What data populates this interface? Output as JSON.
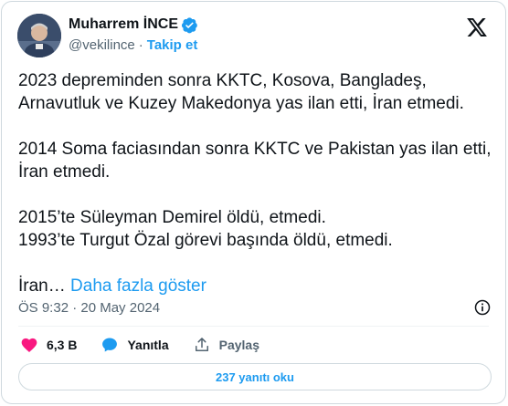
{
  "author": {
    "name": "Muharrem İNCE",
    "handle": "@vekilince",
    "separator": "·",
    "follow_label": "Takip et"
  },
  "tweet": {
    "paragraphs": [
      "2023 depreminden sonra KKTC, Kosova, Bangladeş, Arnavutluk ve Kuzey Makedonya yas ilan etti, İran etmedi.",
      "2014 Soma faciasından sonra KKTC ve Pakistan yas ilan etti, İran etmedi.",
      "2015’te Süleyman Demirel öldü, etmedi.",
      "1993’te Turgut Özal görevi başında öldü, etmedi.",
      "İran…"
    ],
    "show_more": "Daha fazla göster"
  },
  "meta": {
    "timestamp": "ÖS 9:32 · 20 May 2024"
  },
  "actions": {
    "likes": "6,3 B",
    "reply_label": "Yanıtla",
    "share_label": "Paylaş"
  },
  "replies_button": "237 yanıtı oku",
  "colors": {
    "accent": "#1d9bf0",
    "like": "#f91880",
    "text": "#0f1419",
    "muted": "#536471",
    "border": "#cfd9de"
  },
  "icons": [
    "verified-badge-icon",
    "x-logo-icon",
    "info-icon",
    "heart-icon",
    "reply-bubble-icon",
    "share-icon"
  ]
}
